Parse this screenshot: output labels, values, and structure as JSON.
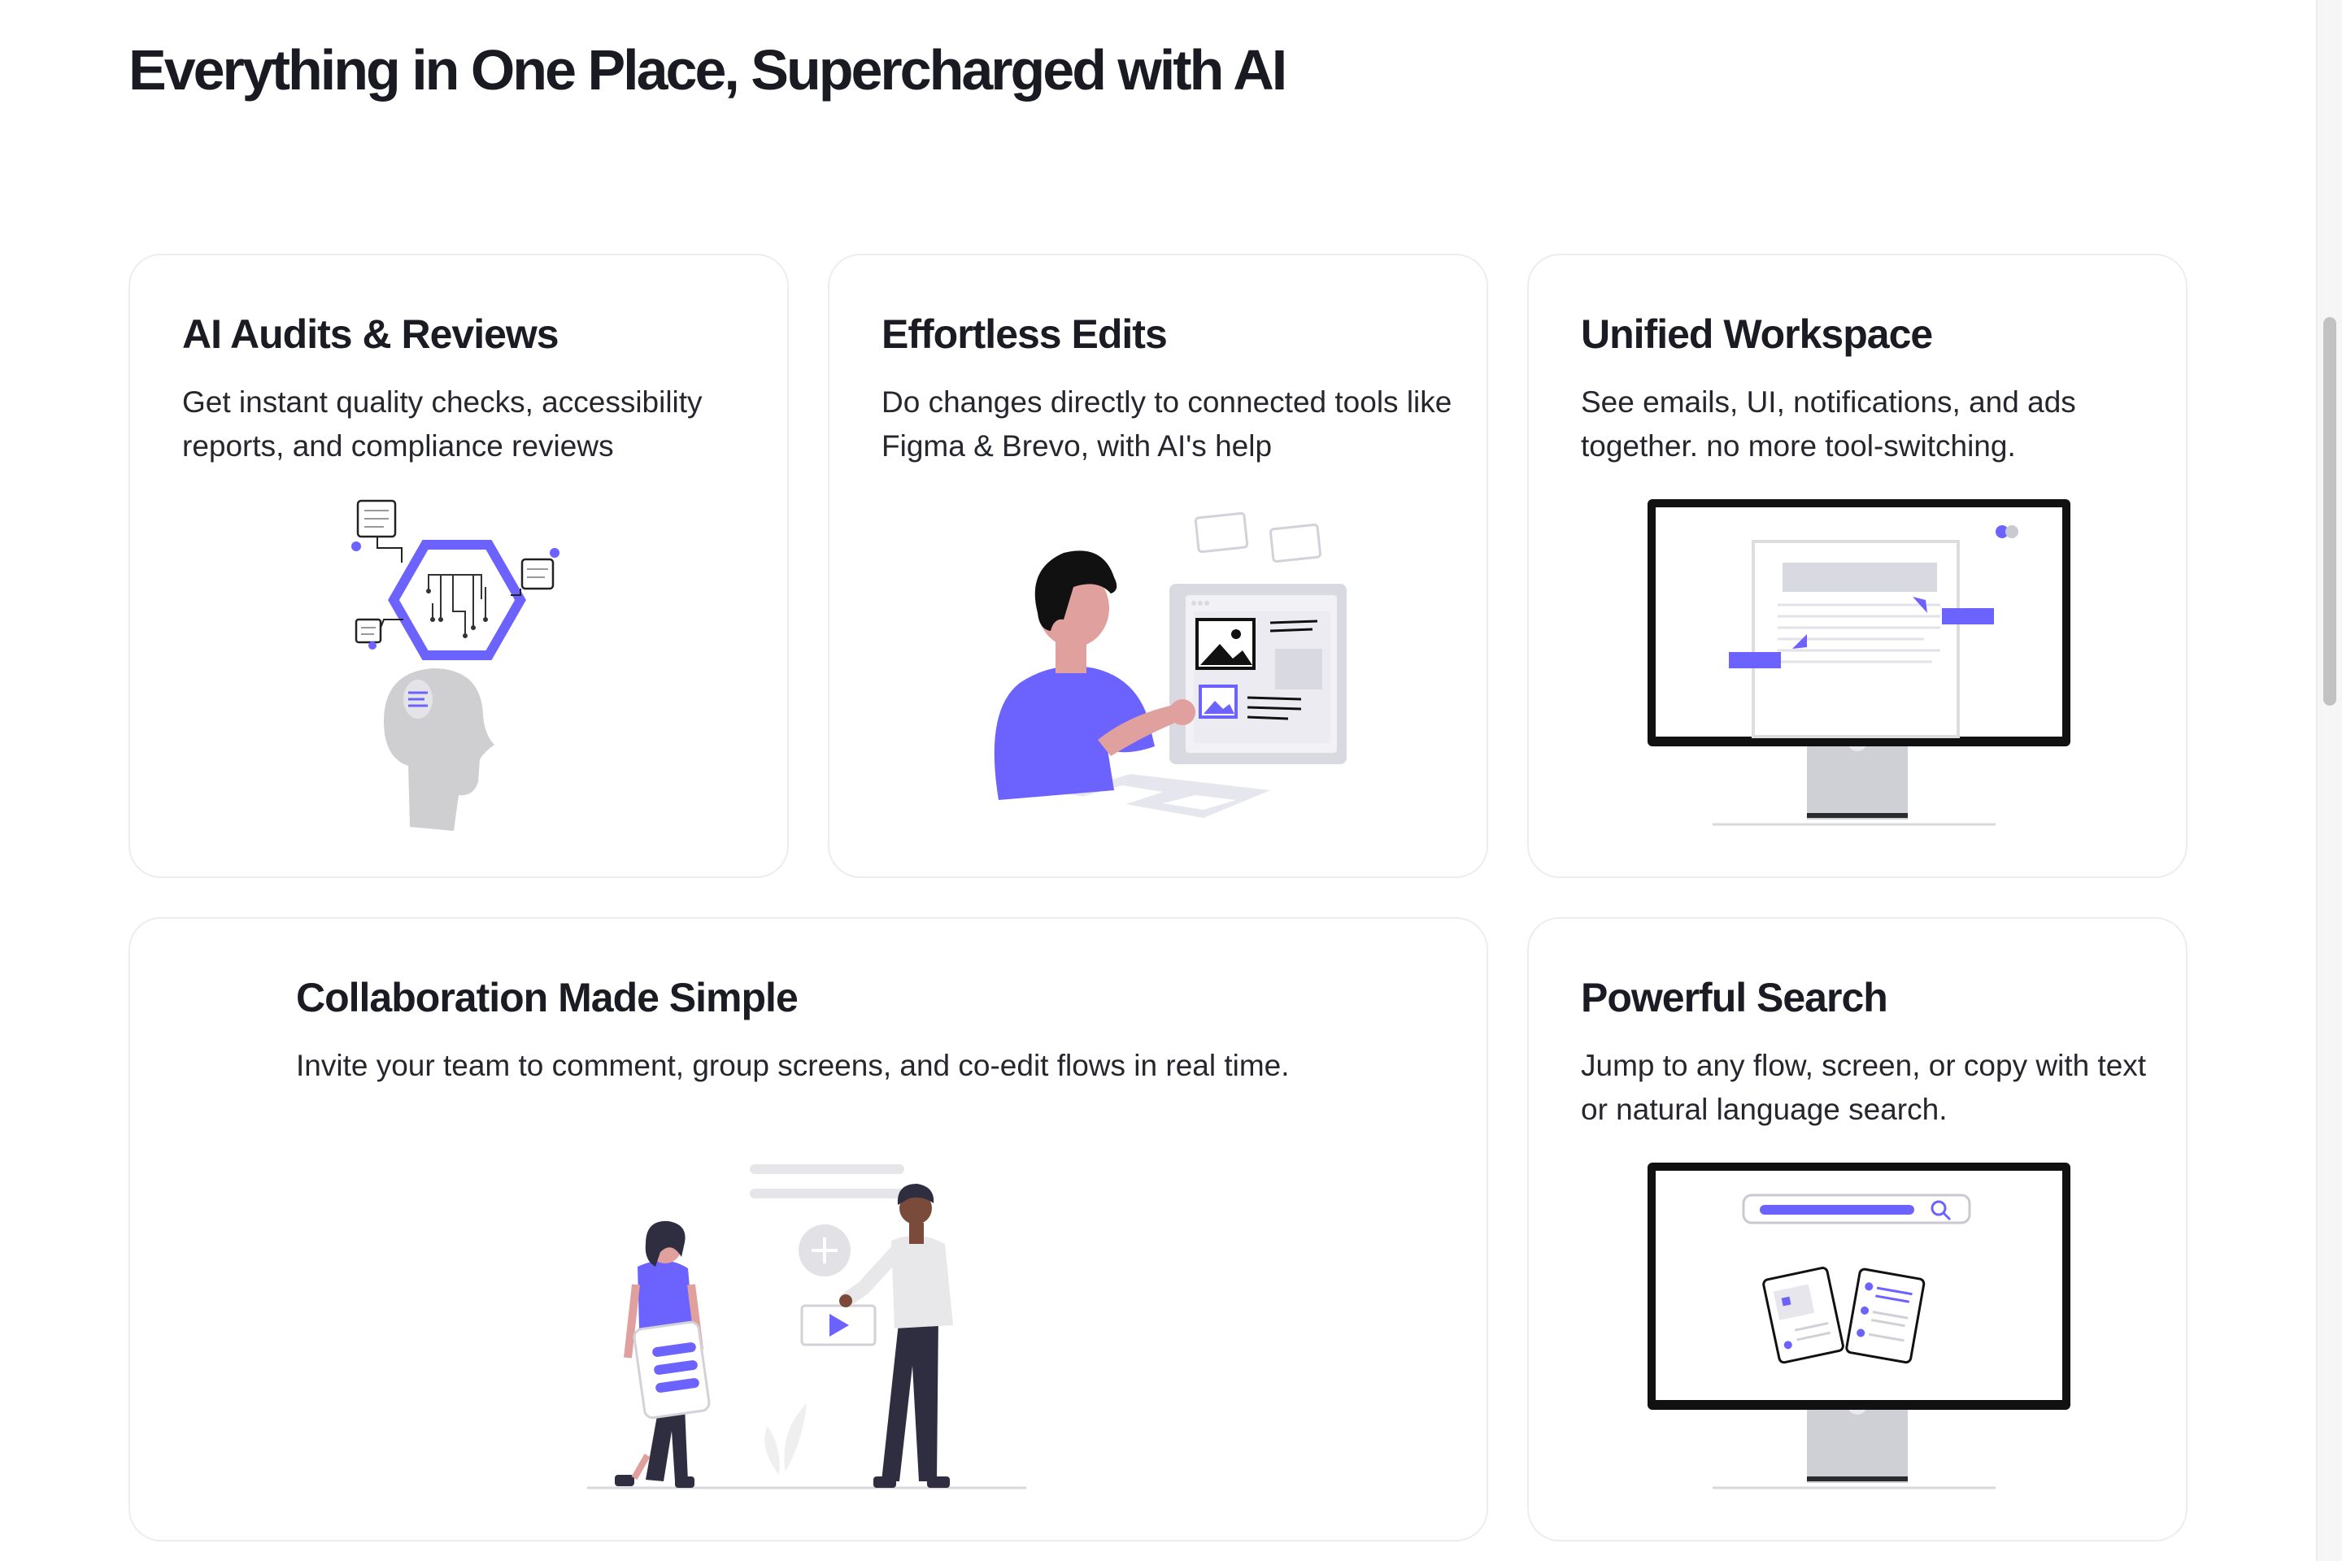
{
  "header": {
    "title": "Everything in One Place, Supercharged with AI"
  },
  "cards": [
    {
      "title": "AI Audits & Reviews",
      "description": "Get instant quality checks, accessibility reports, and compliance reviews",
      "illustration": "ai-brain-circuit-icon"
    },
    {
      "title": "Effortless Edits",
      "description": "Do changes directly to connected tools like Figma & Brevo, with AI's help",
      "illustration": "person-editing-screen-icon"
    },
    {
      "title": "Unified Workspace",
      "description": "See emails, UI, notifications, and ads together. no more tool-switching.",
      "illustration": "monitor-workspace-icon"
    },
    {
      "title": "Collaboration Made Simple",
      "description": "Invite your team to comment, group screens, and co-edit flows in real time.",
      "illustration": "team-collaboration-icon"
    },
    {
      "title": "Powerful Search",
      "description": "Jump to any flow, screen, or copy with text or natural language search.",
      "illustration": "monitor-search-icon"
    }
  ],
  "colors": {
    "accent": "#6c63ff",
    "text": "#1a1a22",
    "card_border": "#ececf1",
    "illustration_gray": "#d4d4de"
  }
}
